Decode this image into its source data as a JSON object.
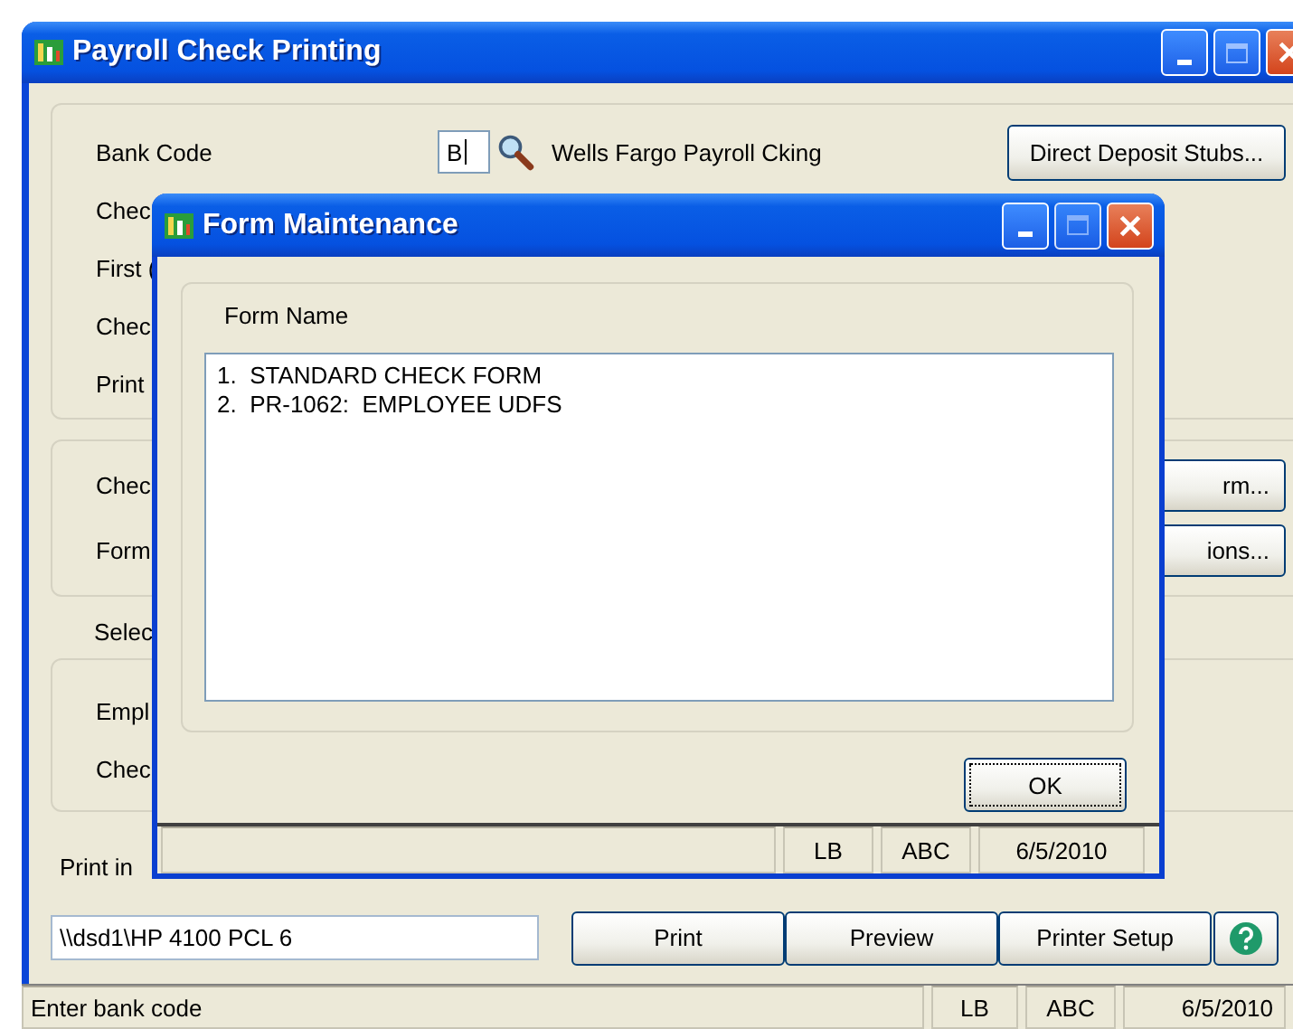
{
  "main_window": {
    "title": "Payroll Check Printing",
    "bank_code": {
      "label": "Bank Code",
      "value": "B",
      "description": "Wells Fargo Payroll Cking"
    },
    "direct_deposit_button": "Direct Deposit Stubs...",
    "group1_labels": [
      "Chec",
      "First (",
      "Chec",
      "Print"
    ],
    "group2_labels": [
      "Chec",
      "Form"
    ],
    "group2_buttons": [
      "rm...",
      "ions..."
    ],
    "select_label": "Selec",
    "group3_labels": [
      "Empl",
      "Chec"
    ],
    "print_in_label": "Print in",
    "printer": {
      "value": "\\\\dsd1\\HP 4100 PCL 6"
    },
    "buttons": [
      "Print",
      "Preview",
      "Printer Setup"
    ],
    "status_bar": {
      "message": "Enter bank code",
      "cells": [
        "LB",
        "ABC",
        "6/5/2010"
      ]
    }
  },
  "dialog": {
    "title": "Form Maintenance",
    "group_label": "Form Name",
    "forms": [
      "1.  STANDARD CHECK FORM",
      "2.  PR-1062:  EMPLOYEE UDFS"
    ],
    "ok_button": "OK",
    "status_bar": {
      "cells": [
        "LB",
        "ABC",
        "6/5/2010"
      ]
    }
  }
}
